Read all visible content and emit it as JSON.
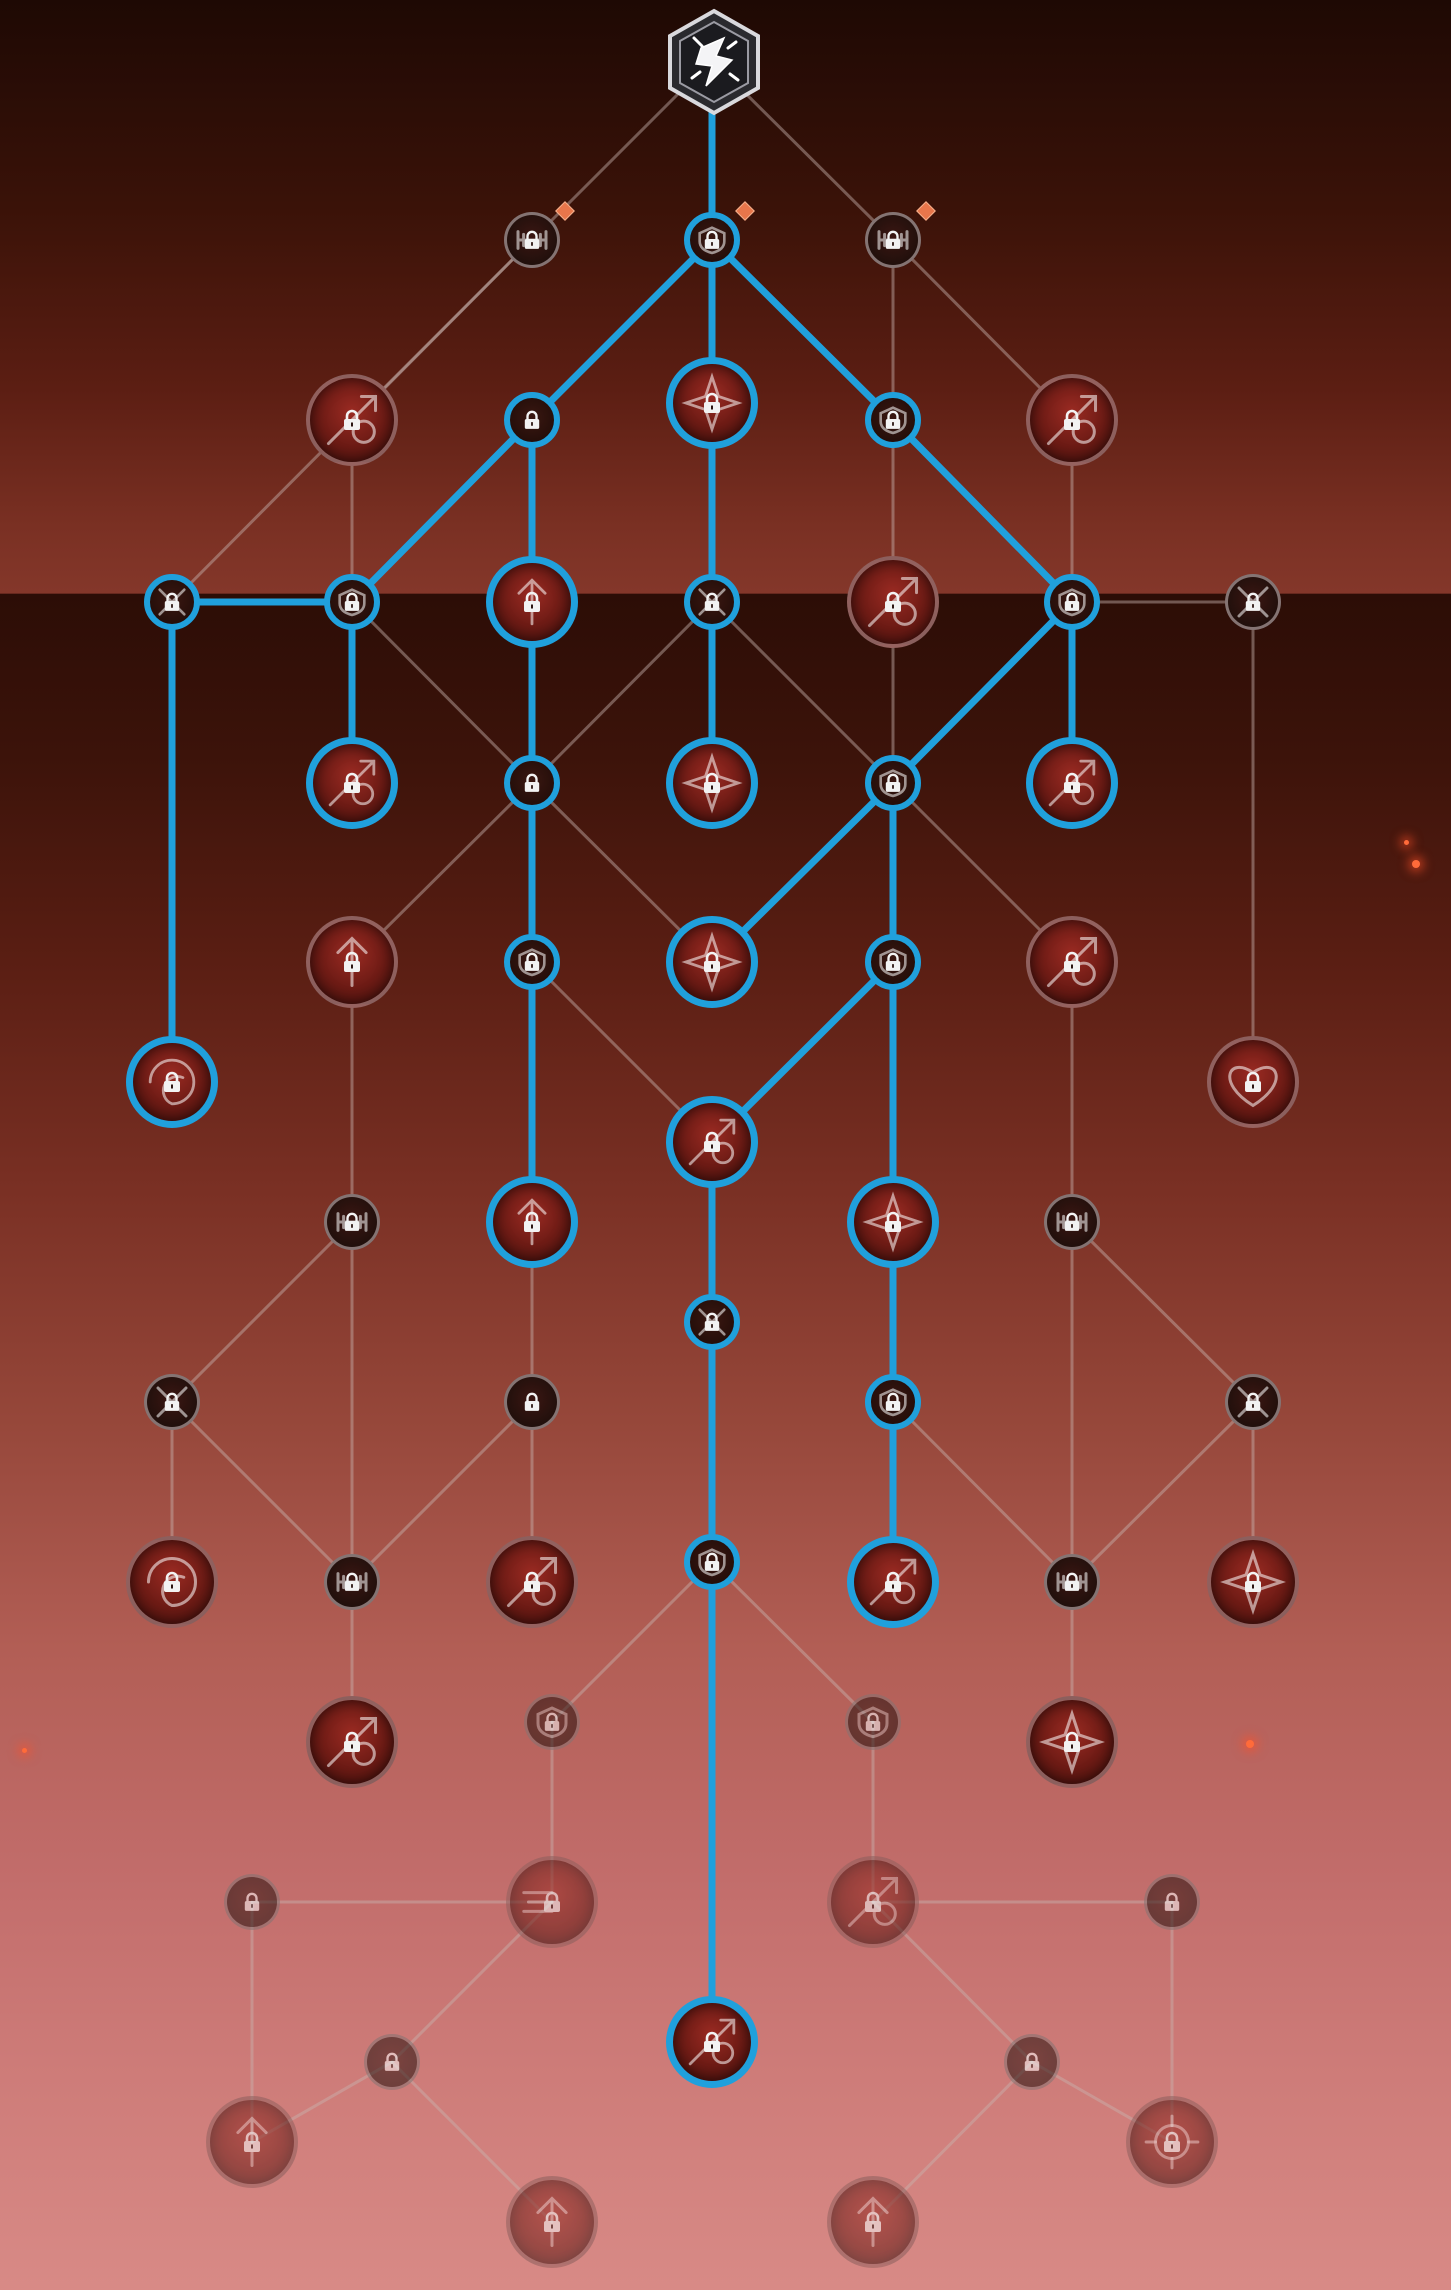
{
  "screen": "skill-tree",
  "colors": {
    "active_edge": "#20a0dc",
    "inactive_edge": "#c8b4b0",
    "lock_glyph": "#f2f2f2",
    "warn_badge": "#e8764b"
  },
  "root": {
    "icon": "class-emblem-icon",
    "state": "unlocked"
  },
  "nodes": [
    {
      "id": "n1",
      "size": "small",
      "active": false,
      "icon": "barbell-icon",
      "badge": true
    },
    {
      "id": "n2",
      "size": "small",
      "active": true,
      "icon": "shield-icon",
      "badge": true
    },
    {
      "id": "n3",
      "size": "small",
      "active": false,
      "icon": "barbell-icon",
      "badge": true
    },
    {
      "id": "n4",
      "size": "large",
      "active": false,
      "icon": "sword-plus-icon"
    },
    {
      "id": "n5",
      "size": "small",
      "active": true,
      "icon": "lock-icon"
    },
    {
      "id": "n6",
      "size": "large",
      "active": true,
      "icon": "burst-icon"
    },
    {
      "id": "n7",
      "size": "small",
      "active": true,
      "icon": "shield-icon"
    },
    {
      "id": "n8",
      "size": "large",
      "active": false,
      "icon": "sword-plus-icon"
    },
    {
      "id": "n9",
      "size": "small",
      "active": true,
      "icon": "crossed-swords-icon"
    },
    {
      "id": "n10",
      "size": "small",
      "active": true,
      "icon": "shield-icon"
    },
    {
      "id": "n11",
      "size": "large",
      "active": true,
      "icon": "sword-up-icon"
    },
    {
      "id": "n12",
      "size": "small",
      "active": true,
      "icon": "crossed-swords-icon"
    },
    {
      "id": "n13",
      "size": "large",
      "active": false,
      "icon": "slash-icon"
    },
    {
      "id": "n14",
      "size": "small",
      "active": true,
      "icon": "shield-icon"
    },
    {
      "id": "n15",
      "size": "small",
      "active": false,
      "icon": "crossed-swords-icon"
    },
    {
      "id": "n16",
      "size": "large",
      "active": true,
      "icon": "sword-plus-icon"
    },
    {
      "id": "n17",
      "size": "small",
      "active": true,
      "icon": "lock-icon"
    },
    {
      "id": "n18",
      "size": "large",
      "active": true,
      "icon": "rising-burst-icon"
    },
    {
      "id": "n19",
      "size": "small",
      "active": true,
      "icon": "shield-icon"
    },
    {
      "id": "n20",
      "size": "large",
      "active": true,
      "icon": "sword-plus-icon"
    },
    {
      "id": "n21",
      "size": "large",
      "active": false,
      "icon": "arrows-up-icon"
    },
    {
      "id": "n22",
      "size": "small",
      "active": true,
      "icon": "shield-icon"
    },
    {
      "id": "n23",
      "size": "large",
      "active": true,
      "icon": "burst-icon"
    },
    {
      "id": "n24",
      "size": "small",
      "active": true,
      "icon": "shield-icon"
    },
    {
      "id": "n25",
      "size": "large",
      "active": false,
      "icon": "sword-plus-icon"
    },
    {
      "id": "n26",
      "size": "large",
      "active": true,
      "icon": "swirl-icon"
    },
    {
      "id": "n27",
      "size": "large",
      "active": false,
      "icon": "heart-icon"
    },
    {
      "id": "n28",
      "size": "large",
      "active": true,
      "icon": "sword-slash-icon"
    },
    {
      "id": "n29",
      "size": "small",
      "active": false,
      "icon": "barbell-icon"
    },
    {
      "id": "n30",
      "size": "large",
      "active": true,
      "icon": "sword-up-icon"
    },
    {
      "id": "n31",
      "size": "large",
      "active": true,
      "icon": "burst-icon"
    },
    {
      "id": "n32",
      "size": "small",
      "active": false,
      "icon": "barbell-icon"
    },
    {
      "id": "n33",
      "size": "small",
      "active": true,
      "icon": "crossed-swords-icon"
    },
    {
      "id": "n34",
      "size": "small",
      "active": false,
      "icon": "crossed-swords-icon"
    },
    {
      "id": "n35",
      "size": "small",
      "active": false,
      "icon": "lock-icon"
    },
    {
      "id": "n36",
      "size": "small",
      "active": true,
      "icon": "shield-icon"
    },
    {
      "id": "n37",
      "size": "small",
      "active": false,
      "icon": "crossed-swords-icon"
    },
    {
      "id": "n38",
      "size": "large",
      "active": false,
      "icon": "swirl-icon"
    },
    {
      "id": "n39",
      "size": "small",
      "active": false,
      "icon": "barbell-icon"
    },
    {
      "id": "n40",
      "size": "large",
      "active": false,
      "icon": "slash-icon"
    },
    {
      "id": "n41",
      "size": "small",
      "active": true,
      "icon": "shield-icon"
    },
    {
      "id": "n42",
      "size": "large",
      "active": true,
      "icon": "slash-icon"
    },
    {
      "id": "n43",
      "size": "small",
      "active": false,
      "icon": "barbell-icon"
    },
    {
      "id": "n44",
      "size": "large",
      "active": false,
      "icon": "sparkle-icon"
    },
    {
      "id": "n45",
      "size": "large",
      "active": false,
      "icon": "sword-plus-icon"
    },
    {
      "id": "n46",
      "size": "small",
      "active": false,
      "icon": "shield-icon",
      "dim": true
    },
    {
      "id": "n47",
      "size": "small",
      "active": false,
      "icon": "shield-icon",
      "dim": true
    },
    {
      "id": "n48",
      "size": "large",
      "active": false,
      "icon": "star-sword-icon"
    },
    {
      "id": "n49",
      "size": "small",
      "active": false,
      "icon": "lock-icon",
      "dim": true
    },
    {
      "id": "n50",
      "size": "large",
      "active": false,
      "icon": "dash-icon",
      "dim": true
    },
    {
      "id": "n51",
      "size": "large",
      "active": false,
      "icon": "slash-icon",
      "dim": true
    },
    {
      "id": "n52",
      "size": "small",
      "active": false,
      "icon": "lock-icon",
      "dim": true
    },
    {
      "id": "n53",
      "size": "small",
      "active": false,
      "icon": "lock-icon",
      "dim": true
    },
    {
      "id": "n54",
      "size": "large",
      "active": true,
      "icon": "slash-plus-icon"
    },
    {
      "id": "n55",
      "size": "small",
      "active": false,
      "icon": "lock-icon",
      "dim": true
    },
    {
      "id": "n56",
      "size": "large",
      "active": false,
      "icon": "arrows-up-icon",
      "dim": true
    },
    {
      "id": "n57",
      "size": "large",
      "active": false,
      "icon": "sword-up-icon",
      "dim": true
    },
    {
      "id": "n58",
      "size": "large",
      "active": false,
      "icon": "arrows-up-icon",
      "dim": true
    },
    {
      "id": "n59",
      "size": "large",
      "active": false,
      "icon": "gear-icon",
      "dim": true
    }
  ],
  "edges": [
    [
      "root",
      "n1",
      false
    ],
    [
      "root",
      "n2",
      true
    ],
    [
      "root",
      "n3",
      false
    ],
    [
      "n1",
      "n4",
      false
    ],
    [
      "n1",
      "n9",
      false
    ],
    [
      "n2",
      "n5",
      true
    ],
    [
      "n2",
      "n6",
      true
    ],
    [
      "n2",
      "n7",
      true
    ],
    [
      "n3",
      "n8",
      false
    ],
    [
      "n3",
      "n13",
      false
    ],
    [
      "n5",
      "n10",
      true
    ],
    [
      "n5",
      "n11",
      true
    ],
    [
      "n7",
      "n14",
      true
    ],
    [
      "n8",
      "n14",
      false
    ],
    [
      "n4",
      "n10",
      false
    ],
    [
      "n9",
      "n10",
      true
    ],
    [
      "n9",
      "n26",
      true
    ],
    [
      "n10",
      "n16",
      true
    ],
    [
      "n10",
      "n17",
      false
    ],
    [
      "n11",
      "n17",
      true
    ],
    [
      "n6",
      "n12",
      true
    ],
    [
      "n12",
      "n18",
      true
    ],
    [
      "n12",
      "n17",
      false
    ],
    [
      "n12",
      "n19",
      false
    ],
    [
      "n14",
      "n19",
      true
    ],
    [
      "n14",
      "n20",
      true
    ],
    [
      "n14",
      "n15",
      false
    ],
    [
      "n15",
      "n27",
      false
    ],
    [
      "n13",
      "n19",
      false
    ],
    [
      "n17",
      "n21",
      false
    ],
    [
      "n17",
      "n22",
      true
    ],
    [
      "n17",
      "n23",
      false
    ],
    [
      "n19",
      "n23",
      true
    ],
    [
      "n19",
      "n24",
      true
    ],
    [
      "n19",
      "n25",
      false
    ],
    [
      "n21",
      "n29",
      false
    ],
    [
      "n22",
      "n30",
      true
    ],
    [
      "n22",
      "n28",
      false
    ],
    [
      "n24",
      "n28",
      true
    ],
    [
      "n24",
      "n31",
      true
    ],
    [
      "n25",
      "n32",
      false
    ],
    [
      "n28",
      "n33",
      true
    ],
    [
      "n29",
      "n34",
      false
    ],
    [
      "n29",
      "n39",
      false
    ],
    [
      "n30",
      "n35",
      false
    ],
    [
      "n31",
      "n36",
      true
    ],
    [
      "n32",
      "n37",
      false
    ],
    [
      "n32",
      "n43",
      false
    ],
    [
      "n34",
      "n38",
      false
    ],
    [
      "n34",
      "n39",
      false
    ],
    [
      "n35",
      "n39",
      false
    ],
    [
      "n35",
      "n40",
      false
    ],
    [
      "n36",
      "n42",
      true
    ],
    [
      "n36",
      "n43",
      false
    ],
    [
      "n37",
      "n43",
      false
    ],
    [
      "n37",
      "n44",
      false
    ],
    [
      "n33",
      "n41",
      true
    ],
    [
      "n39",
      "n45",
      false
    ],
    [
      "n43",
      "n48",
      false
    ],
    [
      "n41",
      "n46",
      false
    ],
    [
      "n41",
      "n47",
      false
    ],
    [
      "n41",
      "n54",
      true
    ],
    [
      "n46",
      "n50",
      false
    ],
    [
      "n47",
      "n51",
      false
    ],
    [
      "n49",
      "n50",
      false
    ],
    [
      "n51",
      "n52",
      false
    ],
    [
      "n49",
      "n56",
      false
    ],
    [
      "n50",
      "n53",
      false
    ],
    [
      "n53",
      "n56",
      false
    ],
    [
      "n53",
      "n57",
      false
    ],
    [
      "n51",
      "n55",
      false
    ],
    [
      "n55",
      "n58",
      false
    ],
    [
      "n55",
      "n59",
      false
    ],
    [
      "n52",
      "n59",
      false
    ]
  ]
}
